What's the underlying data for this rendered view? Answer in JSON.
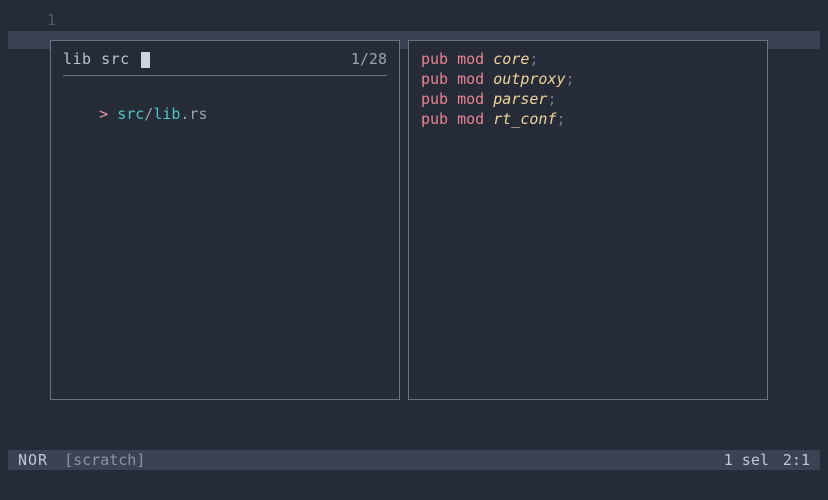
{
  "gutter": {
    "line1": "1"
  },
  "picker": {
    "title": "lib src",
    "count": "1/28",
    "prompt": ">",
    "result": {
      "pre": "",
      "src": "src",
      "slash": "/",
      "lib": "lib",
      "rest": ".rs"
    }
  },
  "preview": {
    "lines": [
      {
        "kw1": "pub",
        "kw2": "mod",
        "ident": "core",
        "semi": ";"
      },
      {
        "kw1": "pub",
        "kw2": "mod",
        "ident": "outproxy",
        "semi": ";"
      },
      {
        "kw1": "pub",
        "kw2": "mod",
        "ident": "parser",
        "semi": ";"
      },
      {
        "kw1": "pub",
        "kw2": "mod",
        "ident": "rt_conf",
        "semi": ";"
      }
    ]
  },
  "status": {
    "mode": "NOR",
    "file": "[scratch]",
    "sel": "1 sel",
    "pos": "2:1"
  }
}
